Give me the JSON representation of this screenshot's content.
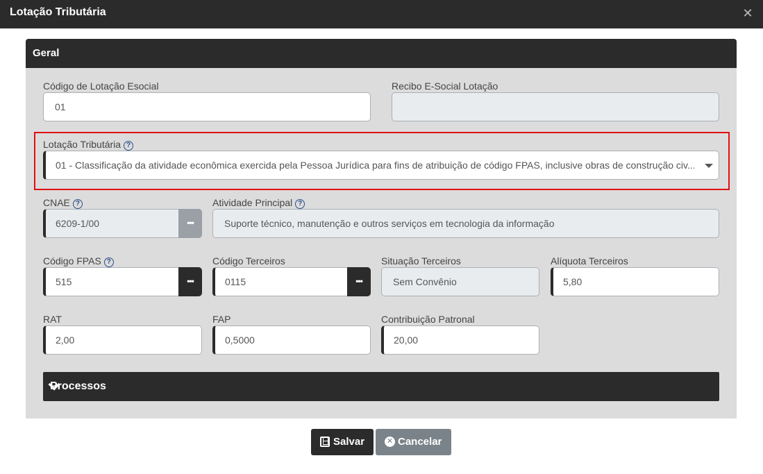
{
  "window": {
    "title": "Lotação Tributária",
    "close_icon": "close-icon"
  },
  "panel": {
    "title": "Geral"
  },
  "fields": {
    "codigo_lotacao": {
      "label": "Código de Lotação Esocial",
      "value": "01"
    },
    "recibo": {
      "label": "Recibo E-Social Lotação",
      "value": ""
    },
    "lotacao_tributaria": {
      "label": "Lotação Tributária",
      "value": "01 - Classificação da atividade econômica exercida pela Pessoa Jurídica para fins de atribuição de código FPAS, inclusive obras de construção civ..."
    },
    "cnae": {
      "label": "CNAE",
      "value": "6209-1/00"
    },
    "atividade": {
      "label": "Atividade Principal",
      "value": "Suporte técnico, manutenção e outros serviços em tecnologia da informação"
    },
    "codigo_fpas": {
      "label": "Código FPAS",
      "value": "515"
    },
    "codigo_terceiros": {
      "label": "Código Terceiros",
      "value": "0115"
    },
    "situacao_terceiros": {
      "label": "Situação Terceiros",
      "value": "Sem Convênio"
    },
    "aliquota_terceiros": {
      "label": "Alíquota Terceiros",
      "value": "5,80"
    },
    "rat": {
      "label": "RAT",
      "value": "2,00"
    },
    "fap": {
      "label": "FAP",
      "value": "0,5000"
    },
    "contribuicao": {
      "label": "Contribuição Patronal",
      "value": "20,00"
    }
  },
  "lookup_glyph": "•••",
  "help_glyph": "?",
  "processos": {
    "title": "Processos"
  },
  "buttons": {
    "save": "Salvar",
    "cancel": "Cancelar",
    "cancel_glyph": "✕"
  },
  "colors": {
    "dark": "#2b2b2b",
    "highlight": "#e01010",
    "panel": "#dcdcdc"
  }
}
